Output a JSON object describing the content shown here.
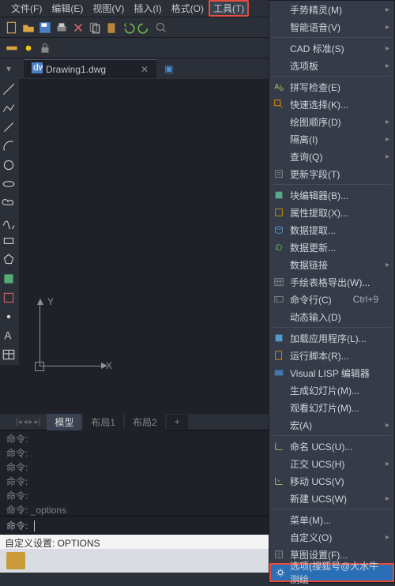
{
  "menubar": {
    "file": "文件(F)",
    "edit": "编辑(E)",
    "view": "视图(V)",
    "insert": "插入(I)",
    "format": "格式(O)",
    "tools": "工具(T)"
  },
  "file_tab": {
    "name": "Drawing1.dwg"
  },
  "layout_tabs": {
    "model": "模型",
    "layout1": "布局1",
    "layout2": "布局2"
  },
  "canvas": {
    "x_label": "X",
    "y_label": "Y"
  },
  "cmd": {
    "lines": [
      "命令:",
      "命令:",
      "命令:",
      "命令:",
      "命令:",
      "命令: _options"
    ],
    "prompt": "命令:"
  },
  "status": "自定义设置: OPTIONS",
  "dropdown": {
    "items": [
      {
        "label": "手势精灵(M)",
        "sub": true,
        "icon": null
      },
      {
        "label": "智能语音(V)",
        "sub": true,
        "icon": null
      },
      {
        "sep": true
      },
      {
        "label": "CAD 标准(S)",
        "sub": true,
        "icon": null
      },
      {
        "label": "选项板",
        "sub": true,
        "icon": null
      },
      {
        "sep": true
      },
      {
        "label": "拼写检查(E)",
        "icon": "spell"
      },
      {
        "label": "快速选择(K)...",
        "icon": "qsel"
      },
      {
        "label": "绘图顺序(D)",
        "sub": true,
        "icon": null
      },
      {
        "label": "隔离(I)",
        "sub": true,
        "icon": null
      },
      {
        "label": "查询(Q)",
        "sub": true,
        "icon": null
      },
      {
        "label": "更新字段(T)",
        "icon": "field"
      },
      {
        "sep": true
      },
      {
        "label": "块编辑器(B)...",
        "icon": "block"
      },
      {
        "label": "属性提取(X)...",
        "icon": "attr"
      },
      {
        "label": "数据提取...",
        "icon": "data"
      },
      {
        "label": "数据更新...",
        "icon": "refresh"
      },
      {
        "label": "数据链接",
        "sub": true,
        "icon": null
      },
      {
        "label": "手绘表格导出(W)...",
        "icon": "table"
      },
      {
        "label": "命令行(C)",
        "icon": "cmd",
        "shortcut": "Ctrl+9"
      },
      {
        "label": "动态输入(D)",
        "icon": null
      },
      {
        "sep": true
      },
      {
        "label": "加载应用程序(L)...",
        "icon": "app"
      },
      {
        "label": "运行脚本(R)...",
        "icon": "script"
      },
      {
        "label": "Visual LISP 编辑器",
        "icon": "lisp"
      },
      {
        "label": "生成幻灯片(M)...",
        "icon": null
      },
      {
        "label": "观看幻灯片(M)...",
        "icon": null
      },
      {
        "label": "宏(A)",
        "sub": true,
        "icon": null
      },
      {
        "sep": true
      },
      {
        "label": "命名 UCS(U)...",
        "icon": "ucs"
      },
      {
        "label": "正交 UCS(H)",
        "sub": true,
        "icon": null
      },
      {
        "label": "移动 UCS(V)",
        "icon": "mucs"
      },
      {
        "label": "新建 UCS(W)",
        "sub": true,
        "icon": null
      },
      {
        "sep": true
      },
      {
        "label": "菜单(M)...",
        "icon": null
      },
      {
        "label": "自定义(O)",
        "sub": true,
        "icon": null
      },
      {
        "label": "草图设置(F)...",
        "icon": "sketch"
      },
      {
        "label": "选项(搜狐号@大水牛测绘",
        "icon": "gear",
        "highlight": true
      }
    ]
  }
}
